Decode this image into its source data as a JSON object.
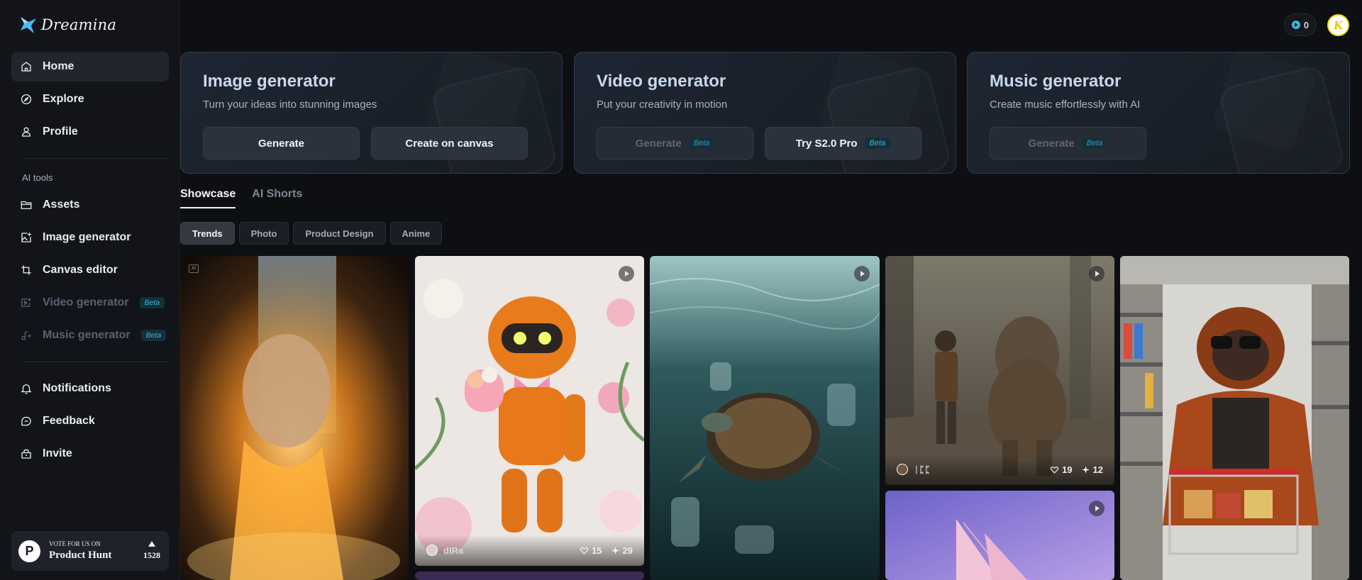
{
  "app": {
    "logo_text": "Dreamina"
  },
  "sidebar": {
    "nav": [
      {
        "label": "Home",
        "icon": "home-icon"
      },
      {
        "label": "Explore",
        "icon": "compass-icon"
      },
      {
        "label": "Profile",
        "icon": "user-icon"
      }
    ],
    "ai_tools_label": "AI tools",
    "tools": [
      {
        "label": "Assets",
        "icon": "folder-icon"
      },
      {
        "label": "Image generator",
        "icon": "image-plus-icon"
      },
      {
        "label": "Canvas editor",
        "icon": "crop-icon"
      },
      {
        "label": "Video generator",
        "icon": "video-plus-icon",
        "badge": "Beta"
      },
      {
        "label": "Music generator",
        "icon": "music-plus-icon",
        "badge": "Beta"
      }
    ],
    "bottom": [
      {
        "label": "Notifications",
        "icon": "bell-icon"
      },
      {
        "label": "Feedback",
        "icon": "chat-icon"
      },
      {
        "label": "Invite",
        "icon": "gift-icon"
      }
    ],
    "product_hunt": {
      "small": "VOTE FOR US ON",
      "big": "Product Hunt",
      "count": "1528",
      "logo_letter": "P"
    }
  },
  "header": {
    "credits": "0",
    "avatar_letter": "K"
  },
  "generators": {
    "image": {
      "title": "Image generator",
      "subtitle": "Turn your ideas into stunning images",
      "primary": "Generate",
      "secondary": "Create on canvas"
    },
    "video": {
      "title": "Video generator",
      "subtitle": "Put your creativity in motion",
      "primary": "Generate",
      "primary_badge": "Beta",
      "secondary": "Try S2.0 Pro",
      "secondary_badge": "Beta"
    },
    "music": {
      "title": "Music generator",
      "subtitle": "Create music effortlessly with AI",
      "primary": "Generate",
      "primary_badge": "Beta"
    }
  },
  "tabs": [
    "Showcase",
    "AI Shorts"
  ],
  "filters": [
    "Trends",
    "Photo",
    "Product Design",
    "Anime"
  ],
  "gallery": [
    {
      "name": "robot",
      "user": "dIRa",
      "likes": "15",
      "remixes": "29"
    },
    {
      "name": "bigfoot",
      "user": "ᛁᛈᛈ",
      "likes": "19",
      "remixes": "12"
    }
  ],
  "colors": {
    "accent": "#3fb6d8",
    "background": "#0d0f13",
    "sidebar": "#121419"
  }
}
